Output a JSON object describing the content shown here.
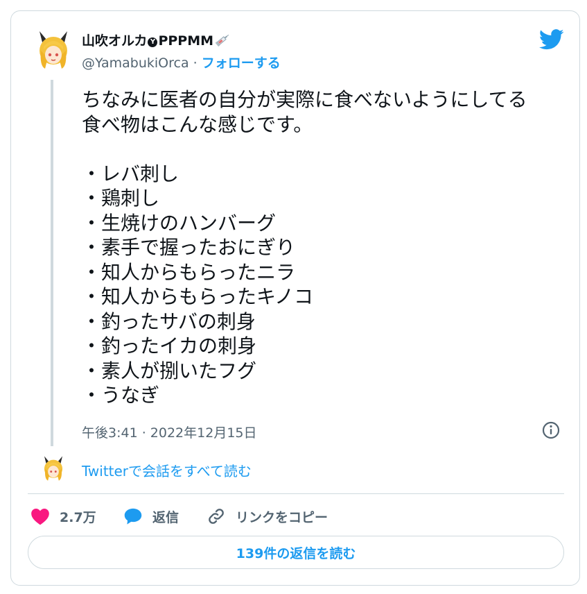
{
  "user": {
    "display_name": "山吹オルカ",
    "badge": "Y",
    "name_suffix": "PPPMM",
    "handle": "@YamabukiOrca",
    "separator": " · ",
    "follow_label": "フォローする"
  },
  "tweet": {
    "lines": [
      "ちなみに医者の自分が実際に食べないようにしてる",
      "食べ物はこんな感じです。",
      "",
      "・レバ刺し",
      "・鶏刺し",
      "・生焼けのハンバーグ",
      "・素手で握ったおにぎり",
      "・知人からもらったニラ",
      "・知人からもらったキノコ",
      "・釣ったサバの刺身",
      "・釣ったイカの刺身",
      "・素人が捌いたフグ",
      "・うなぎ"
    ],
    "timestamp": "午後3:41 · 2022年12月15日"
  },
  "thread": {
    "read_conversation": "Twitterで会話をすべて読む"
  },
  "actions": {
    "like_count": "2.7万",
    "reply_label": "返信",
    "copy_link_label": "リンクをコピー"
  },
  "footer": {
    "read_replies": "139件の返信を読む"
  },
  "colors": {
    "accent": "#1d9bf0",
    "like": "#f91880",
    "text": "#0f1419",
    "muted": "#536471",
    "border": "#cfd9de"
  },
  "icons": [
    "avatar-image",
    "syringe-icon",
    "twitter-bird-icon",
    "info-icon",
    "heart-icon",
    "reply-bubble-icon",
    "link-icon"
  ]
}
